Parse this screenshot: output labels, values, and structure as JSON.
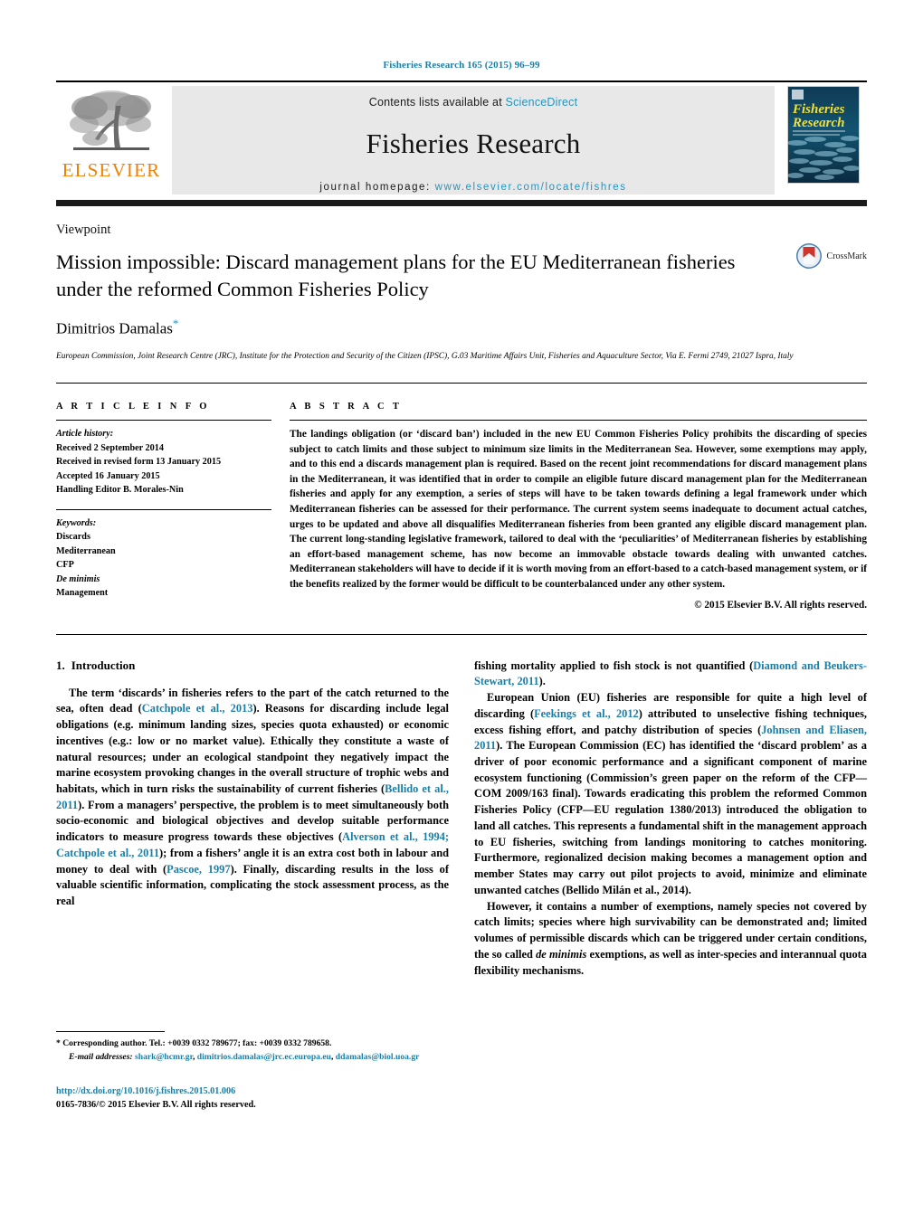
{
  "running_head": "Fisheries Research 165 (2015) 96–99",
  "masthead": {
    "publisher_name": "ELSEVIER",
    "contents_prefix": "Contents lists available at ",
    "contents_link": "ScienceDirect",
    "journal_title": "Fisheries Research",
    "homepage_prefix": "journal homepage: ",
    "homepage_url": "www.elsevier.com/locate/fishres",
    "cover_title_line1": "Fisheries",
    "cover_title_line2": "Research"
  },
  "article": {
    "doctype": "Viewpoint",
    "title": "Mission impossible: Discard management plans for the EU Mediterranean fisheries under the reformed Common Fisheries Policy",
    "author": "Dimitrios Damalas",
    "author_marker": "*",
    "affiliation": "European Commission, Joint Research Centre (JRC), Institute for the Protection and Security of the Citizen (IPSC), G.03 Maritime Affairs Unit, Fisheries and Aquaculture Sector, Via E. Fermi 2749, 21027 Ispra, Italy",
    "crossmark_label": "CrossMark"
  },
  "article_info": {
    "heading": "A R T I C L E   I N F O",
    "history_label": "Article history:",
    "history": [
      "Received 2 September 2014",
      "Received in revised form 13 January 2015",
      "Accepted 16 January 2015",
      "Handling Editor B. Morales-Nin"
    ],
    "keywords_label": "Keywords:",
    "keywords": [
      "Discards",
      "Mediterranean",
      "CFP",
      "De minimis",
      "Management"
    ],
    "keywords_italic_index": 3
  },
  "abstract": {
    "heading": "A B S T R A C T",
    "text": "The landings obligation (or ‘discard ban’) included in the new EU Common Fisheries Policy prohibits the discarding of species subject to catch limits and those subject to minimum size limits in the Mediterranean Sea. However, some exemptions may apply, and to this end a discards management plan is required. Based on the recent joint recommendations for discard management plans in the Mediterranean, it was identified that in order to compile an eligible future discard management plan for the Mediterranean fisheries and apply for any exemption, a series of steps will have to be taken towards defining a legal framework under which Mediterranean fisheries can be assessed for their performance. The current system seems inadequate to document actual catches, urges to be updated and above all disqualifies Mediterranean fisheries from been granted any eligible discard management plan. The current long-standing legislative framework, tailored to deal with the ‘peculiarities’ of Mediterranean fisheries by establishing an effort-based management scheme, has now become an immovable obstacle towards dealing with unwanted catches. Mediterranean stakeholders will have to decide if it is worth moving from an effort-based to a catch-based management system, or if the benefits realized by the former would be difficult to be counterbalanced under any other system.",
    "copyright": "© 2015 Elsevier B.V. All rights reserved."
  },
  "section": {
    "number": "1.",
    "title": "Introduction"
  },
  "body": {
    "left_p1_a": "The term ‘discards’ in fisheries refers to the part of the catch returned to the sea, often dead (",
    "left_p1_ref1": "Catchpole et al., 2013",
    "left_p1_b": "). Reasons for discarding include legal obligations (e.g. minimum landing sizes, species quota exhausted) or economic incentives (e.g.: low or no market value). Ethically they constitute a waste of natural resources; under an ecological standpoint they negatively impact the marine ecosystem provoking changes in the overall structure of trophic webs and habitats, which in turn risks the sustainability of current fisheries (",
    "left_p1_ref2": "Bellido et al., 2011",
    "left_p1_c": "). From a managers’ perspective, the problem is to meet simultaneously both socio-economic and biological objectives and develop suitable performance indicators to measure progress towards these objectives (",
    "left_p1_ref3": "Alverson et al., 1994; Catchpole et al., 2011",
    "left_p1_d": "); from a fishers’ angle it is an extra cost both in labour and money to deal with (",
    "left_p1_ref4": "Pascoe, 1997",
    "left_p1_e": "). Finally, discarding results in the loss of valuable scientific information, complicating the stock assessment process, as the real ",
    "right_p1_cont_a": "fishing mortality applied to fish stock is not quantified (",
    "right_p1_ref1": "Diamond and Beukers-Stewart, 2011",
    "right_p1_cont_b": ").",
    "right_p2_a": "European Union (EU) fisheries are responsible for quite a high level of discarding (",
    "right_p2_ref1": "Feekings et al., 2012",
    "right_p2_b": ") attributed to unselective fishing techniques, excess fishing effort, and patchy distribution of species (",
    "right_p2_ref2": "Johnsen and Eliasen, 2011",
    "right_p2_c": "). The European Commission (EC) has identified the ‘discard problem’ as a driver of poor economic performance and a significant component of marine ecosystem functioning (Commission’s green paper on the reform of the CFP—COM 2009/163 final). Towards eradicating this problem the reformed Common Fisheries Policy (CFP—EU regulation 1380/2013) introduced the obligation to land all catches. This represents a fundamental shift in the management approach to EU fisheries, switching from landings monitoring to catches monitoring. Furthermore, regionalized decision making becomes a management option and member States may carry out pilot projects to avoid, minimize and eliminate unwanted catches (Bellido Milán et al., 2014).",
    "right_p3_a": "However, it contains a number of exemptions, namely species not covered by catch limits; species where high survivability can be demonstrated and; limited volumes of permissible discards which can be triggered under certain conditions, the so called ",
    "right_p3_ital": "de minimis",
    "right_p3_b": " exemptions, as well as inter-species and interannual quota flexibility mechanisms."
  },
  "footnote": {
    "corresponding": "* Corresponding author. Tel.: +0039 0332 789677; fax: +0039 0332 789658.",
    "email_label": "E-mail addresses:",
    "emails": [
      "shark@hcmr.gr",
      "dimitrios.damalas@jrc.ec.europa.eu",
      "ddamalas@biol.uoa.gr"
    ],
    "doi": "http://dx.doi.org/10.1016/j.fishres.2015.01.006",
    "issn": "0165-7836/© 2015 Elsevier B.V. All rights reserved."
  },
  "colors": {
    "link": "#1a7fa8",
    "sciencedirect": "#2196c4",
    "elsevier_orange": "#f08000",
    "header_gray": "#e8e8e8"
  }
}
